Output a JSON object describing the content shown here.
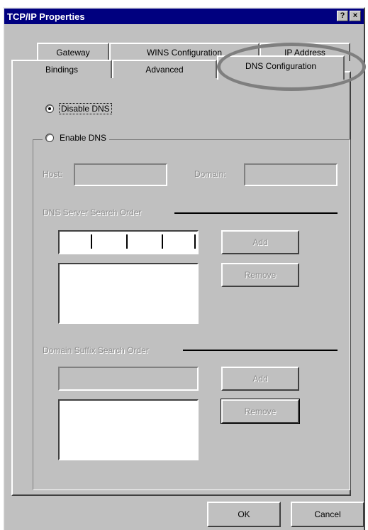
{
  "window": {
    "title": "TCP/IP Properties",
    "help_button": "?",
    "close_button": "×"
  },
  "tabs": {
    "row1": [
      "Gateway",
      "WINS Configuration",
      "IP Address"
    ],
    "row2": [
      "Bindings",
      "Advanced",
      "DNS Configuration"
    ],
    "active": "DNS Configuration"
  },
  "dns": {
    "disable_label": "Disable DNS",
    "enable_label": "Enable DNS",
    "selected": "disable",
    "host_label": "Host:",
    "host_value": "",
    "domain_label": "Domain:",
    "domain_value": "",
    "server_order_label": "DNS Server Search Order",
    "server_ip_value": "",
    "server_add_label": "Add",
    "server_remove_label": "Remove",
    "suffix_order_label": "Domain Suffix Search Order",
    "suffix_value": "",
    "suffix_add_label": "Add",
    "suffix_remove_label": "Remove"
  },
  "footer": {
    "ok_label": "OK",
    "cancel_label": "Cancel"
  },
  "colors": {
    "titlebar": "#00007f",
    "face": "#c0c0c0",
    "highlight_ellipse": "#7f7f7f"
  }
}
